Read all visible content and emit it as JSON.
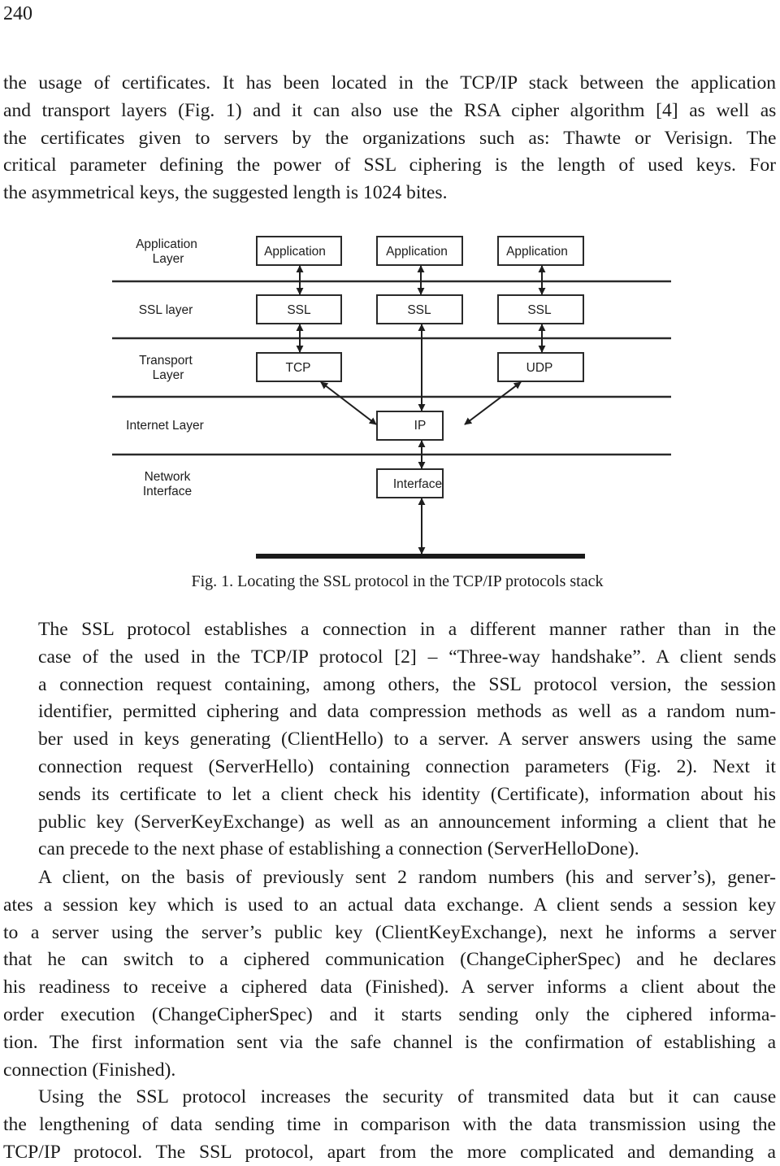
{
  "page": {
    "number": "240"
  },
  "paragraphs": {
    "intro": {
      "lines": [
        "the usage of certificates. It has been located in the TCP/IP stack between the application",
        "and transport layers (Fig. 1) and it can also use the RSA cipher algorithm [4] as well as",
        "the certificates given to servers by the organizations such as: Thawte or Verisign. The",
        "critical parameter defining the power of SSL ciphering is the length of used keys. For",
        "the asymmetrical keys, the suggested length is 1024 bites."
      ]
    },
    "handshake": {
      "lines": [
        "The SSL protocol establishes a connection in a different manner rather than in the",
        "case of the used in the TCP/IP protocol [2] – “Three-way handshake”. A client sends",
        "a connection request containing, among others, the SSL protocol version, the session",
        "identifier, permitted ciphering and data compression methods as well as a random num-",
        "ber used in keys generating (ClientHello) to a server. A server answers using the same",
        "connection request (ServerHello) containing connection parameters (Fig. 2). Next it",
        "sends its certificate to let a client check his identity (Certificate), information about his",
        "public key (ServerKeyExchange) as well as an announcement informing a client that he",
        "can precede to the next phase of establishing a connection (ServerHelloDone)."
      ]
    },
    "client": {
      "lines": [
        "A client, on the basis of previously sent 2 random numbers (his and server’s), gener-",
        "ates a session key which is used to an actual data exchange. A client sends a session key",
        "to a server using the server’s public key (ClientKeyExchange), next he informs a server",
        "that he can switch to a ciphered communication (ChangeCipherSpec) and he declares",
        "his readiness to receive a ciphered data (Finished). A server informs a client about the",
        "order execution (ChangeCipherSpec) and it starts sending only the ciphered informa-",
        "tion. The first information sent via the safe channel is the confirmation of establishing a",
        "connection (Finished)."
      ]
    },
    "using": {
      "lines": [
        "Using the SSL protocol increases the security of transmited data but it can cause",
        "the lengthening of data sending time in comparison with the data transmission using the",
        "TCP/IP protocol. The SSL protocol, apart from the more complicated and demanding a"
      ]
    }
  },
  "figure": {
    "caption": "Fig. 1. Locating the SSL protocol in the TCP/IP protocols stack",
    "layer_labels": {
      "application": [
        "Application",
        "Layer"
      ],
      "ssl": [
        "SSL layer"
      ],
      "transport": [
        "Transport",
        "Layer"
      ],
      "internet": [
        "Internet Layer"
      ],
      "network": [
        "Network",
        "Interface"
      ]
    },
    "boxes": {
      "app1": "Application",
      "app2": "Application",
      "app3": "Application",
      "ssl1": "SSL",
      "ssl2": "SSL",
      "ssl3": "SSL",
      "tcp": "TCP",
      "udp": "UDP",
      "ip": "IP",
      "interface": "Interface"
    }
  }
}
